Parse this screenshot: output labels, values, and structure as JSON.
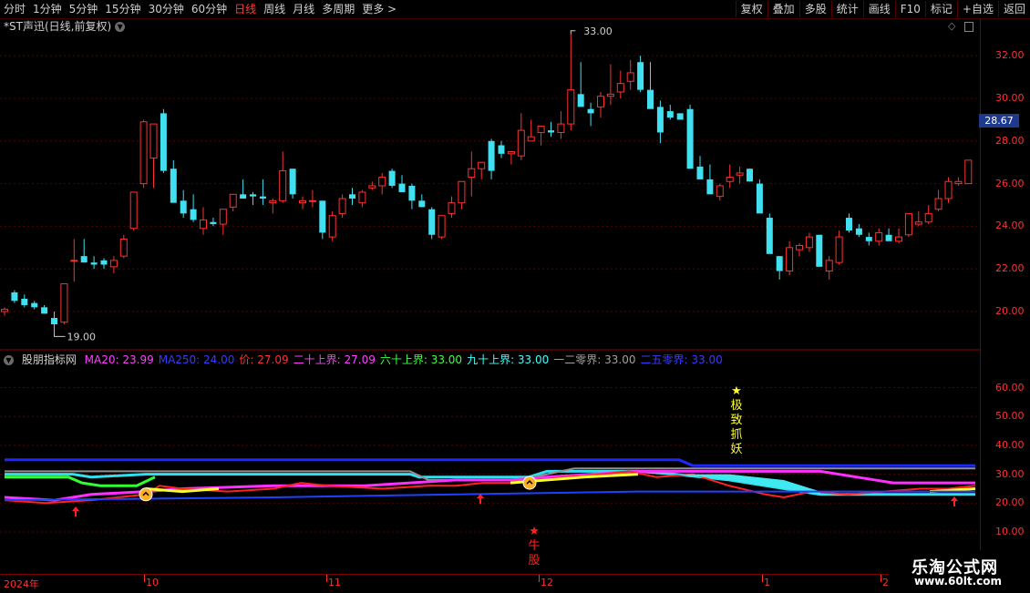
{
  "toolbar": {
    "periods": [
      "分时",
      "1分钟",
      "5分钟",
      "15分钟",
      "30分钟",
      "60分钟",
      "日线",
      "周线",
      "月线",
      "多周期",
      "更多 >"
    ],
    "active_period": "日线",
    "buttons": [
      "复权",
      "叠加",
      "多股",
      "统计",
      "画线",
      "F10",
      "标记",
      "+自选",
      "返回"
    ]
  },
  "chart_title": "*ST声迅(日线,前复权)",
  "main_axis": [
    "32.00",
    "30.00",
    "28.00",
    "26.00",
    "24.00",
    "22.00",
    "20.00"
  ],
  "current_price_tag": "28.67",
  "high_label": "33.00",
  "low_label": "19.00",
  "indicator": {
    "name": "股朋指标网",
    "fields": [
      {
        "label": "MA20: 23.99",
        "color": "#ff40ff"
      },
      {
        "label": "MA250: 24.00",
        "color": "#3a3aff"
      },
      {
        "label": "价: 27.09",
        "color": "#ff3030"
      },
      {
        "label": "二十上界: 27.09",
        "color": "#ff40ff"
      },
      {
        "label": "六十上界: 33.00",
        "color": "#40ff40"
      },
      {
        "label": "九十上界: 33.00",
        "color": "#40ffff"
      },
      {
        "label": "一二零界: 33.00",
        "color": "#a0a0a0"
      },
      {
        "label": "二五零界: 33.00",
        "color": "#3a3aff"
      }
    ],
    "axis": [
      "60.00",
      "50.00",
      "40.00",
      "30.00",
      "20.00",
      "10.00"
    ],
    "text_top_chars": [
      "★",
      "极",
      "致",
      "抓",
      "妖"
    ],
    "text_bottom_chars": [
      "★",
      "牛",
      "股"
    ]
  },
  "dates": [
    {
      "label": "2024年"
    },
    {
      "label": "10"
    },
    {
      "label": "11"
    },
    {
      "label": "12"
    },
    {
      "label": "1"
    },
    {
      "label": "2("
    }
  ],
  "watermark": {
    "line1": "乐淘公式网",
    "line2": "www.60lt.com"
  },
  "colors": {
    "up": "#ff3030",
    "down": "#40e0f0",
    "axis": "#ff3030",
    "grid": "#5a0000"
  },
  "chart_data": {
    "type": "candlestick",
    "ylim": [
      18.5,
      33.5
    ],
    "candles": [
      [
        20.0,
        20.2,
        19.8,
        20.1
      ],
      [
        20.9,
        21.0,
        20.4,
        20.5
      ],
      [
        20.6,
        20.8,
        20.2,
        20.3
      ],
      [
        20.4,
        20.5,
        20.1,
        20.2
      ],
      [
        20.2,
        20.3,
        19.9,
        19.9
      ],
      [
        19.7,
        20.0,
        19.0,
        19.4
      ],
      [
        19.5,
        21.3,
        19.4,
        21.3
      ],
      [
        22.4,
        23.4,
        21.4,
        22.4
      ],
      [
        22.6,
        23.4,
        22.3,
        22.3
      ],
      [
        22.3,
        22.6,
        22.0,
        22.2
      ],
      [
        22.4,
        22.5,
        22.0,
        22.2
      ],
      [
        22.1,
        22.6,
        21.8,
        22.4
      ],
      [
        22.6,
        23.6,
        22.5,
        23.4
      ],
      [
        23.9,
        25.6,
        23.8,
        25.6
      ],
      [
        26.0,
        29.0,
        25.8,
        28.9
      ],
      [
        27.2,
        28.8,
        25.8,
        28.8
      ],
      [
        29.3,
        29.5,
        26.5,
        26.6
      ],
      [
        26.7,
        27.1,
        25.2,
        25.1
      ],
      [
        25.2,
        25.7,
        24.4,
        24.6
      ],
      [
        24.8,
        25.5,
        24.2,
        24.3
      ],
      [
        23.9,
        24.9,
        23.6,
        24.3
      ],
      [
        24.2,
        24.4,
        24.0,
        24.1
      ],
      [
        24.1,
        24.5,
        23.6,
        24.8
      ],
      [
        24.9,
        25.2,
        24.7,
        25.5
      ],
      [
        25.5,
        26.2,
        25.3,
        25.3
      ],
      [
        25.5,
        25.6,
        25.0,
        25.4
      ],
      [
        25.4,
        26.2,
        25.0,
        25.3
      ],
      [
        25.1,
        25.3,
        24.6,
        25.2
      ],
      [
        25.2,
        27.5,
        25.1,
        26.6
      ],
      [
        26.7,
        26.7,
        25.3,
        25.5
      ],
      [
        25.1,
        25.4,
        24.8,
        25.2
      ],
      [
        25.2,
        25.7,
        24.9,
        25.2
      ],
      [
        25.2,
        25.2,
        23.4,
        23.7
      ],
      [
        23.5,
        24.7,
        23.3,
        24.5
      ],
      [
        24.6,
        25.5,
        24.4,
        25.3
      ],
      [
        25.5,
        25.8,
        25.0,
        25.3
      ],
      [
        25.1,
        25.7,
        24.9,
        25.6
      ],
      [
        25.8,
        26.1,
        25.7,
        25.9
      ],
      [
        25.9,
        26.5,
        25.5,
        26.3
      ],
      [
        26.6,
        26.7,
        25.8,
        25.9
      ],
      [
        26.0,
        26.4,
        25.6,
        25.6
      ],
      [
        25.9,
        26.0,
        24.8,
        25.2
      ],
      [
        25.2,
        25.5,
        24.9,
        24.9
      ],
      [
        24.8,
        24.9,
        23.4,
        23.6
      ],
      [
        23.5,
        24.4,
        23.4,
        24.5
      ],
      [
        24.6,
        25.4,
        24.4,
        25.1
      ],
      [
        25.1,
        26.0,
        24.8,
        26.1
      ],
      [
        26.3,
        27.5,
        25.4,
        26.7
      ],
      [
        26.7,
        26.8,
        26.2,
        27.0
      ],
      [
        28.0,
        28.1,
        26.2,
        26.6
      ],
      [
        27.8,
        28.0,
        27.2,
        27.4
      ],
      [
        27.4,
        27.5,
        26.9,
        27.5
      ],
      [
        27.3,
        29.3,
        27.1,
        28.5
      ],
      [
        28.0,
        29.0,
        28.0,
        28.2
      ],
      [
        28.4,
        28.6,
        27.8,
        28.7
      ],
      [
        28.5,
        28.9,
        28.2,
        28.4
      ],
      [
        28.4,
        29.4,
        28.1,
        28.8
      ],
      [
        28.8,
        33.0,
        28.5,
        30.4
      ],
      [
        30.2,
        31.7,
        29.9,
        29.6
      ],
      [
        29.5,
        29.8,
        28.7,
        29.3
      ],
      [
        29.6,
        30.3,
        29.1,
        30.1
      ],
      [
        30.1,
        31.6,
        29.7,
        30.2
      ],
      [
        30.3,
        31.3,
        30.0,
        30.7
      ],
      [
        30.8,
        31.8,
        30.4,
        31.2
      ],
      [
        31.7,
        32.0,
        30.3,
        30.4
      ],
      [
        30.4,
        31.7,
        29.6,
        29.5
      ],
      [
        29.6,
        29.9,
        27.9,
        28.4
      ],
      [
        29.4,
        29.7,
        29.0,
        29.1
      ],
      [
        29.3,
        29.3,
        29.0,
        29.0
      ],
      [
        29.5,
        29.7,
        26.7,
        26.7
      ],
      [
        26.8,
        27.3,
        26.5,
        26.2
      ],
      [
        26.2,
        26.9,
        25.5,
        25.5
      ],
      [
        25.4,
        26.0,
        25.2,
        25.9
      ],
      [
        26.1,
        26.9,
        25.8,
        26.3
      ],
      [
        26.4,
        26.8,
        26.0,
        26.5
      ],
      [
        26.7,
        26.7,
        26.2,
        26.1
      ],
      [
        26.0,
        26.2,
        24.7,
        24.6
      ],
      [
        24.4,
        24.6,
        23.0,
        22.7
      ],
      [
        22.6,
        22.6,
        21.5,
        21.9
      ],
      [
        21.9,
        23.3,
        21.7,
        23.0
      ],
      [
        22.9,
        23.2,
        22.6,
        23.1
      ],
      [
        23.0,
        23.7,
        22.8,
        23.5
      ],
      [
        23.6,
        23.6,
        22.2,
        22.1
      ],
      [
        21.9,
        22.6,
        21.5,
        22.4
      ],
      [
        22.3,
        23.8,
        22.2,
        23.5
      ],
      [
        24.4,
        24.6,
        23.7,
        23.8
      ],
      [
        23.9,
        24.1,
        23.5,
        23.6
      ],
      [
        23.5,
        23.7,
        23.1,
        23.3
      ],
      [
        23.3,
        23.9,
        23.1,
        23.7
      ],
      [
        23.6,
        23.9,
        23.4,
        23.3
      ],
      [
        23.3,
        23.9,
        23.2,
        23.5
      ],
      [
        23.6,
        24.6,
        23.5,
        24.6
      ],
      [
        24.1,
        24.7,
        24.0,
        24.2
      ],
      [
        24.2,
        25.0,
        24.1,
        24.6
      ],
      [
        24.8,
        25.7,
        24.7,
        25.3
      ],
      [
        25.3,
        26.3,
        25.1,
        26.1
      ],
      [
        26.0,
        26.3,
        25.9,
        26.1
      ],
      [
        26.0,
        27.1,
        26.0,
        27.1
      ]
    ],
    "indicator_ylim": [
      0,
      70
    ]
  }
}
